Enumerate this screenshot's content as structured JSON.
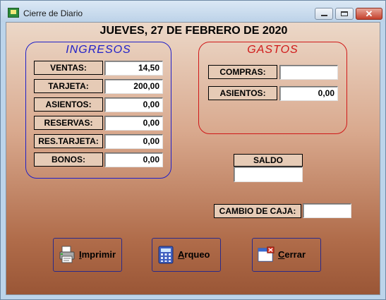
{
  "window": {
    "title": "Cierre de Diario",
    "close_glyph": "✕"
  },
  "date_heading": "JUEVES, 27 DE FEBRERO DE 2020",
  "ingresos": {
    "title": "INGRESOS",
    "rows": [
      {
        "label": "VENTAS:",
        "value": "14,50"
      },
      {
        "label": "TARJETA:",
        "value": "200,00"
      },
      {
        "label": "ASIENTOS:",
        "value": "0,00"
      },
      {
        "label": "RESERVAS:",
        "value": "0,00"
      },
      {
        "label": "RES.TARJETA:",
        "value": "0,00"
      },
      {
        "label": "BONOS:",
        "value": "0,00"
      }
    ]
  },
  "gastos": {
    "title": "GASTOS",
    "rows": [
      {
        "label": "COMPRAS:",
        "value": ""
      },
      {
        "label": "ASIENTOS:",
        "value": "0,00"
      }
    ]
  },
  "saldo": {
    "label": "SALDO",
    "value": ""
  },
  "cambio": {
    "label": "CAMBIO DE CAJA:",
    "value": ""
  },
  "buttons": {
    "print": {
      "label": "Imprimir",
      "icon": "printer-icon"
    },
    "arqueo": {
      "label": "Arqueo",
      "icon": "calculator-icon"
    },
    "close": {
      "label": "Cerrar",
      "icon": "close-window-icon"
    }
  },
  "colors": {
    "ingresos_accent": "#1f1fc8",
    "gastos_accent": "#d01818",
    "label_bg": "#e6cbb6"
  }
}
